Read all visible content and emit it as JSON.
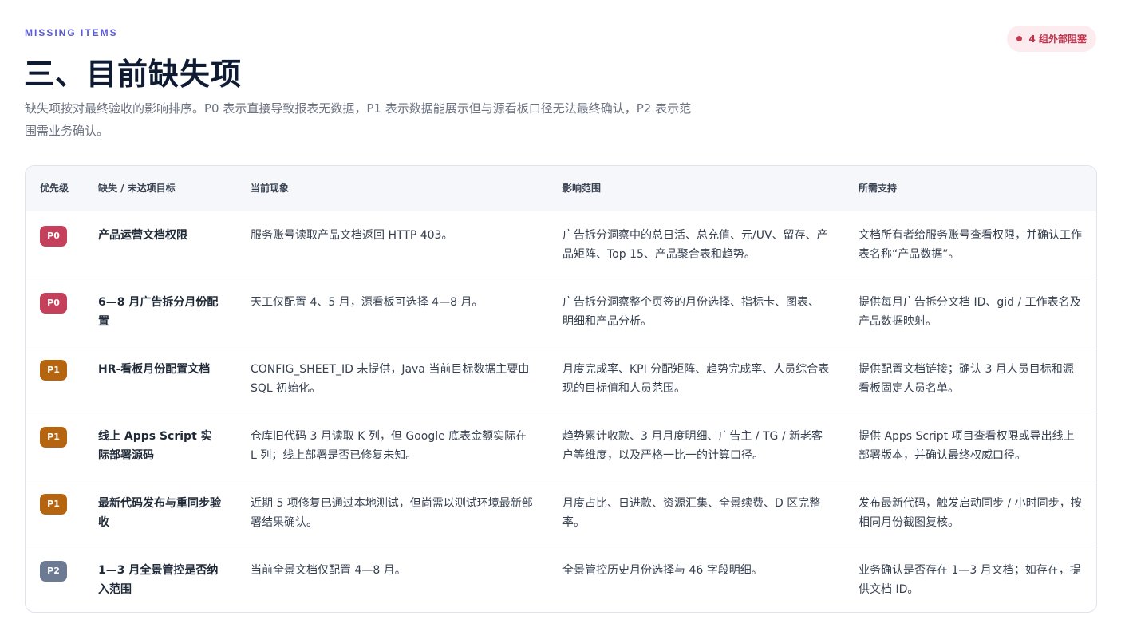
{
  "header": {
    "eyebrow": "MISSING ITEMS",
    "title": "三、目前缺失项",
    "description": "缺失项按对最终验收的影响排序。P0 表示直接导致报表无数据，P1 表示数据能展示但与源看板口径无法最终确认，P2 表示范围需业务确认。",
    "badge": "4 组外部阻塞"
  },
  "colors": {
    "P0": "#c5405a",
    "P1": "#b5650f",
    "P2": "#6c7a93",
    "accent": "#5b5bd6"
  },
  "table": {
    "columns": [
      "优先级",
      "缺失 / 未达项目标",
      "当前现象",
      "影响范围",
      "所需支持"
    ],
    "rows": [
      {
        "priority": "P0",
        "target": "产品运营文档权限",
        "symptom": "服务账号读取产品文档返回 HTTP 403。",
        "impact": "广告拆分洞察中的总日活、总充值、元/UV、留存、产品矩阵、Top 15、产品聚合表和趋势。",
        "support": "文档所有者给服务账号查看权限，并确认工作表名称“产品数据”。"
      },
      {
        "priority": "P0",
        "target": "6—8 月广告拆分月份配置",
        "symptom": "天工仅配置 4、5 月，源看板可选择 4—8 月。",
        "impact": "广告拆分洞察整个页签的月份选择、指标卡、图表、明细和产品分析。",
        "support": "提供每月广告拆分文档 ID、gid / 工作表名及产品数据映射。"
      },
      {
        "priority": "P1",
        "target": "HR-看板月份配置文档",
        "symptom": "CONFIG_SHEET_ID 未提供，Java 当前目标数据主要由 SQL 初始化。",
        "impact": "月度完成率、KPI 分配矩阵、趋势完成率、人员综合表现的目标值和人员范围。",
        "support": "提供配置文档链接；确认 3 月人员目标和源看板固定人员名单。"
      },
      {
        "priority": "P1",
        "target": "线上 Apps Script 实际部署源码",
        "symptom": "仓库旧代码 3 月读取 K 列，但 Google 底表金额实际在 L 列；线上部署是否已修复未知。",
        "impact": "趋势累计收款、3 月月度明细、广告主 / TG / 新老客户等维度，以及严格一比一的计算口径。",
        "support": "提供 Apps Script 项目查看权限或导出线上部署版本，并确认最终权威口径。"
      },
      {
        "priority": "P1",
        "target": "最新代码发布与重同步验收",
        "symptom": "近期 5 项修复已通过本地测试，但尚需以测试环境最新部署结果确认。",
        "impact": "月度占比、日进款、资源汇集、全景续费、D 区完整率。",
        "support": "发布最新代码，触发启动同步 / 小时同步，按相同月份截图复核。"
      },
      {
        "priority": "P2",
        "target": "1—3 月全景管控是否纳入范围",
        "symptom": "当前全景文档仅配置 4—8 月。",
        "impact": "全景管控历史月份选择与 46 字段明细。",
        "support": "业务确认是否存在 1—3 月文档；如存在，提供文档 ID。"
      }
    ]
  }
}
